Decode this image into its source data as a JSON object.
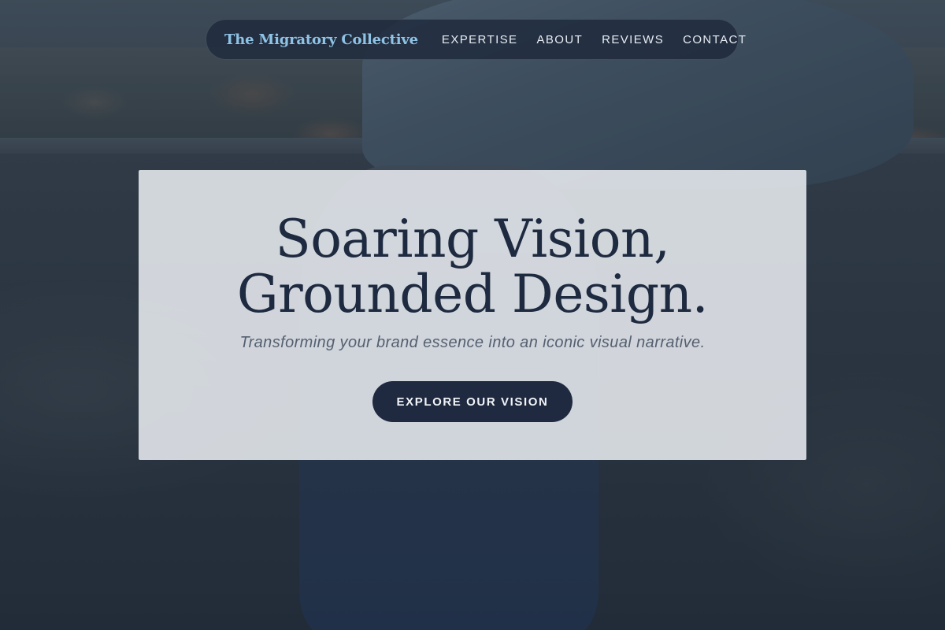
{
  "brand": {
    "name": "The Migratory Collective",
    "color": "#8fc3e6"
  },
  "nav": {
    "links": [
      {
        "label": "EXPERTISE"
      },
      {
        "label": "ABOUT"
      },
      {
        "label": "REVIEWS"
      },
      {
        "label": "CONTACT"
      }
    ]
  },
  "hero": {
    "title_line1": "Soaring Vision,",
    "title_line2": "Grounded Design.",
    "subtitle": "Transforming your brand essence into an iconic visual narrative.",
    "cta_label": "EXPLORE OUR VISION"
  },
  "colors": {
    "primary": "#1f2a40",
    "card_background": "#e8ecf0",
    "subtitle": "#556070"
  }
}
